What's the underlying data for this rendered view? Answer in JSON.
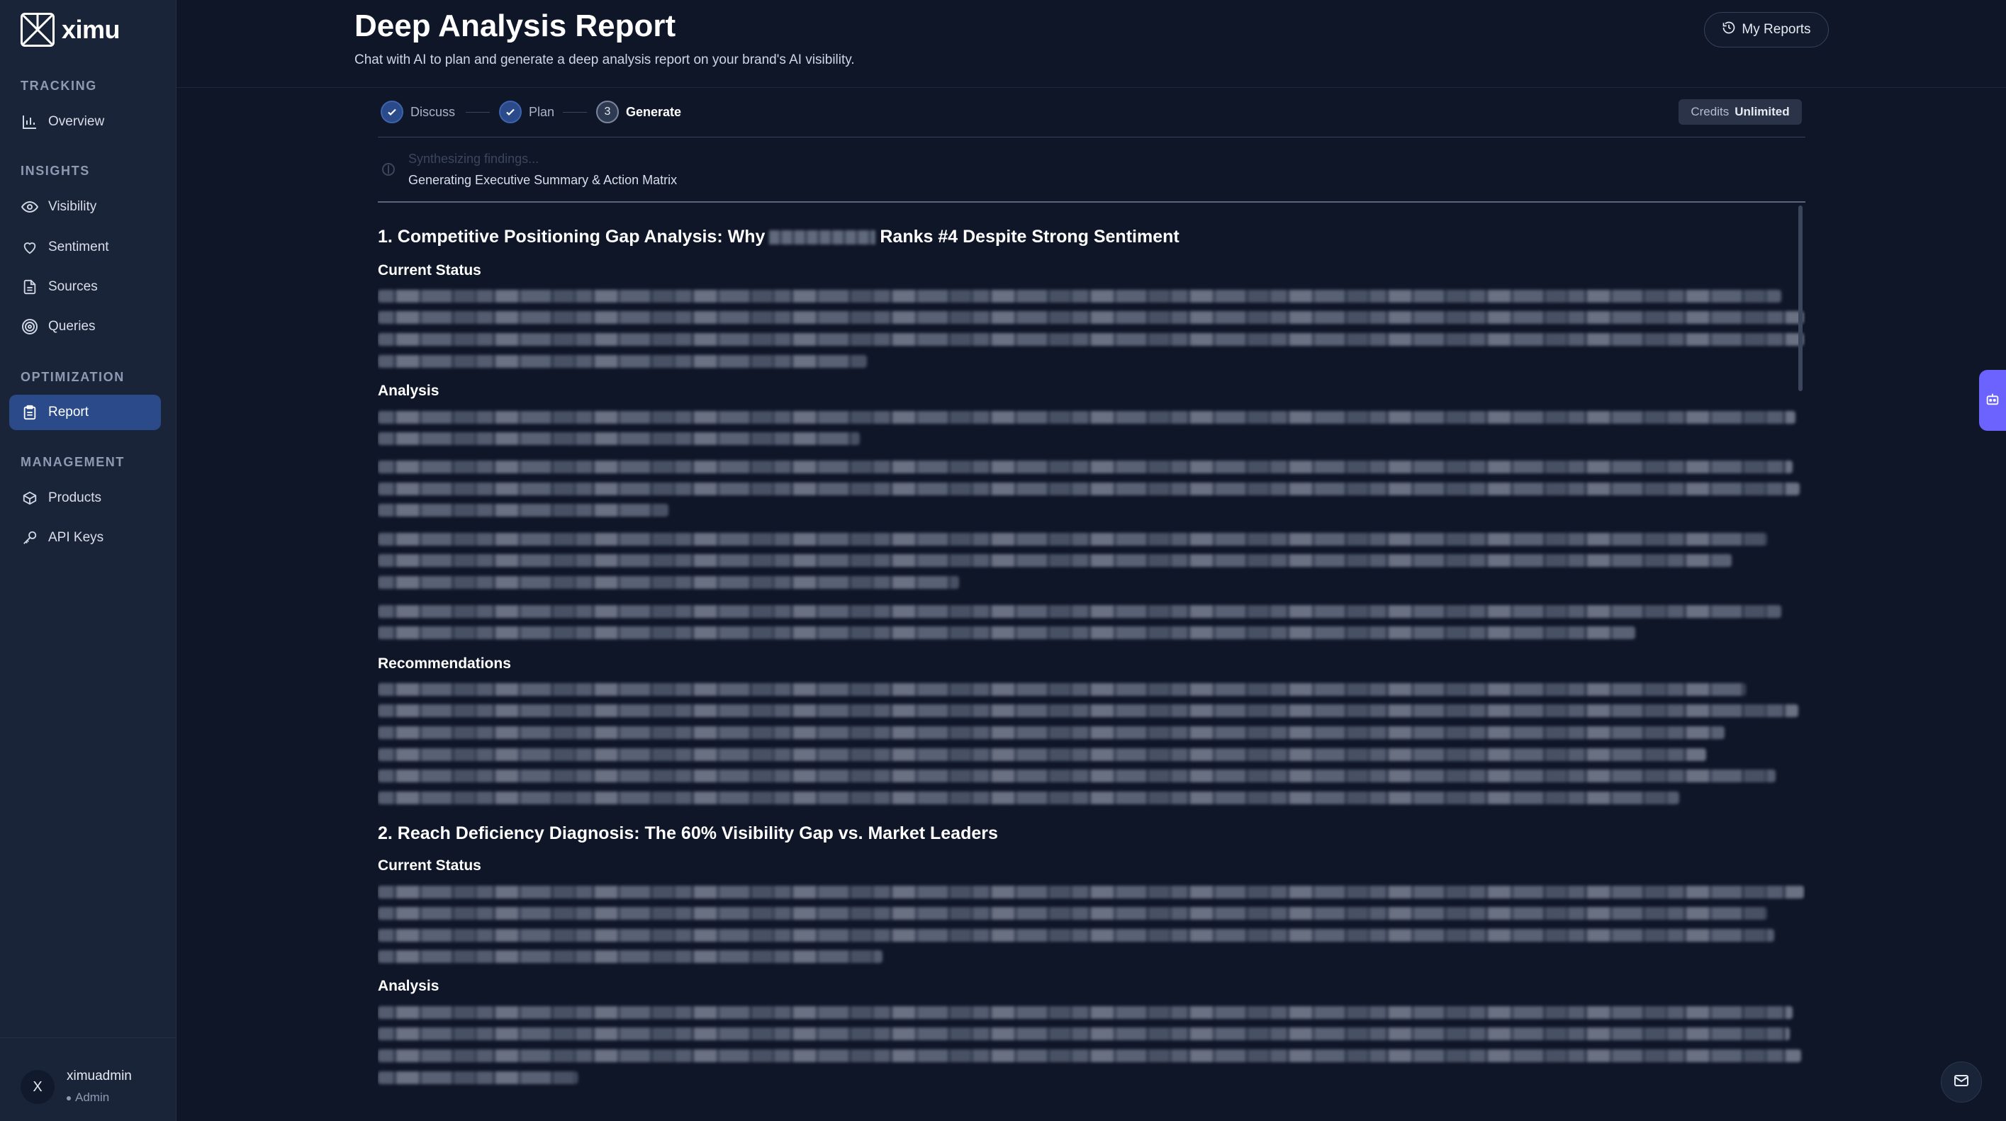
{
  "brand": {
    "name": "ximu"
  },
  "sidebar": {
    "sections": [
      {
        "label": "TRACKING",
        "items": [
          {
            "label": "Overview",
            "icon": "bar-chart-icon"
          }
        ]
      },
      {
        "label": "INSIGHTS",
        "items": [
          {
            "label": "Visibility",
            "icon": "eye-icon"
          },
          {
            "label": "Sentiment",
            "icon": "heart-icon"
          },
          {
            "label": "Sources",
            "icon": "document-icon"
          },
          {
            "label": "Queries",
            "icon": "target-icon"
          }
        ]
      },
      {
        "label": "OPTIMIZATION",
        "items": [
          {
            "label": "Report",
            "icon": "clipboard-icon",
            "active": true
          }
        ]
      },
      {
        "label": "MANAGEMENT",
        "items": [
          {
            "label": "Products",
            "icon": "box-icon"
          },
          {
            "label": "API Keys",
            "icon": "key-icon"
          }
        ]
      }
    ],
    "user": {
      "initial": "X",
      "name": "ximuadmin",
      "role": "Admin"
    }
  },
  "header": {
    "title": "Deep Analysis Report",
    "subtitle": "Chat with AI to plan and generate a deep analysis report on your brand's AI visibility.",
    "my_reports_label": "My Reports"
  },
  "stepper": {
    "steps": [
      {
        "label": "Discuss",
        "state": "done"
      },
      {
        "label": "Plan",
        "state": "done"
      },
      {
        "number": "3",
        "label": "Generate",
        "state": "current"
      }
    ],
    "credits_label": "Credits",
    "credits_value": "Unlimited"
  },
  "status": {
    "faded": "Synthesizing findings...",
    "current": "Generating Executive Summary & Action Matrix"
  },
  "report": {
    "sections": [
      {
        "title_prefix": "1. Competitive Positioning Gap Analysis: Why",
        "title_suffix": "Ranks #4 Despite Strong Sentiment",
        "current_status_label": "Current Status",
        "analysis_label": "Analysis",
        "recommendations_label": "Recommendations"
      },
      {
        "title": "2. Reach Deficiency Diagnosis: The 60% Visibility Gap vs. Market Leaders",
        "current_status_label": "Current Status",
        "analysis_label": "Analysis"
      }
    ]
  },
  "colors": {
    "background": "#0f1628",
    "sidebar": "#1a2438",
    "accent": "#2b4a8a",
    "side_tab": "#6c63ff"
  }
}
